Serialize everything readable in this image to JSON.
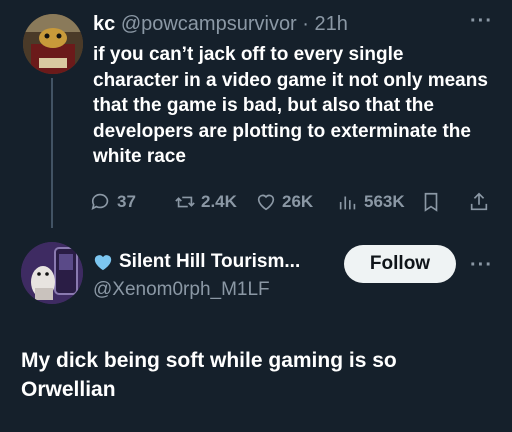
{
  "colors": {
    "background": "#15202b",
    "text": "#e7e9ea",
    "muted": "#8b98a5",
    "follow_bg": "#eff3f4",
    "heart_blue": "#7cc6f0"
  },
  "tweet1": {
    "display_name": "kc",
    "handle": "@powcampsurvivor",
    "separator": "·",
    "time": "21h",
    "text": "if you can’t jack off to every single character in a video game it not only means that the game is bad, but also that the developers are plotting to exterminate the white race",
    "stats": {
      "replies": "37",
      "retweets": "2.4K",
      "likes": "26K",
      "views": "563K"
    },
    "icons": [
      "reply-icon",
      "retweet-icon",
      "like-icon",
      "views-icon",
      "bookmark-icon",
      "share-icon",
      "more-icon"
    ]
  },
  "tweet2": {
    "display_name": "Silent Hill Tourism...",
    "handle": "@Xenom0rph_M1LF",
    "follow_label": "Follow",
    "text": "My dick being soft while gaming is so Orwellian",
    "icons": [
      "blue-heart-icon",
      "more-icon"
    ]
  }
}
